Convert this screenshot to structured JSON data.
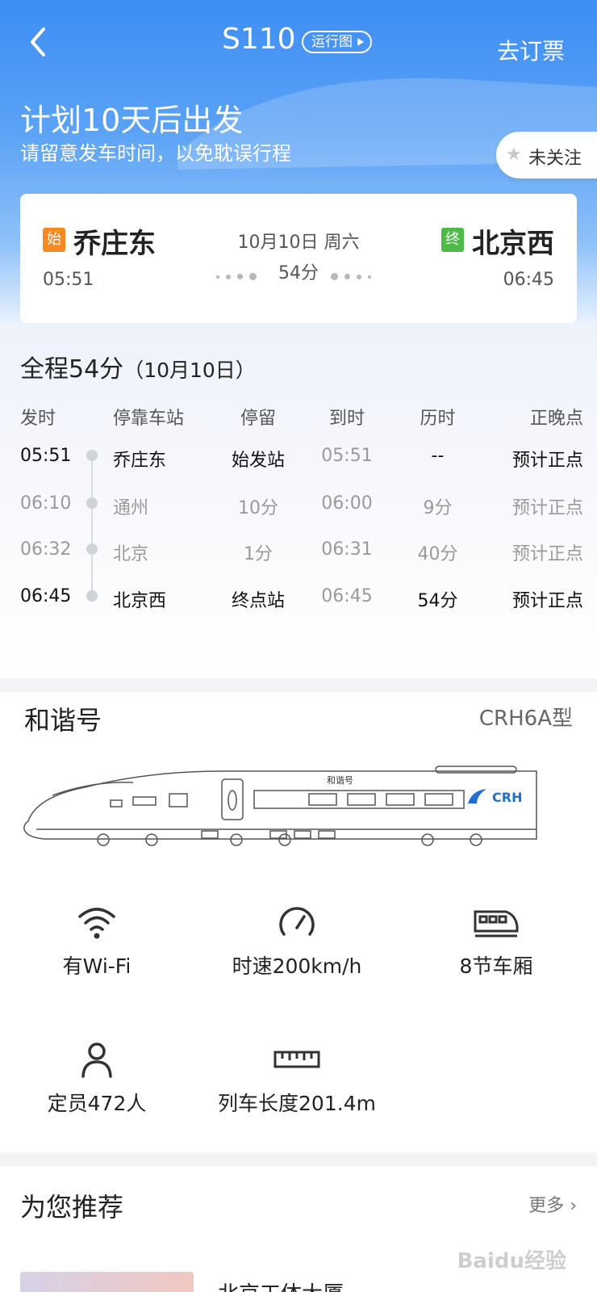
{
  "header": {
    "train_no": "S110",
    "map_badge": "运行图",
    "book_label": "去订票",
    "plan_title": "计划10天后出发",
    "plan_sub": "请留意发车时间，以免耽误行程",
    "follow_label": "未关注"
  },
  "route": {
    "start_tag": "始",
    "end_tag": "终",
    "from": "乔庄东",
    "to": "北京西",
    "depart": "05:51",
    "arrive": "06:45",
    "date": "10月10日 周六",
    "duration": "54分"
  },
  "schedule": {
    "title": "全程54分",
    "title_date": "（10月10日）",
    "headers": [
      "发时",
      "停靠车站",
      "停留",
      "到时",
      "历时",
      "正晚点"
    ],
    "rows": [
      {
        "dep": "05:51",
        "station": "乔庄东",
        "stay": "始发站",
        "arr": "05:51",
        "elapsed": "--",
        "status": "预计正点"
      },
      {
        "dep": "06:10",
        "station": "通州",
        "stay": "10分",
        "arr": "06:00",
        "elapsed": "9分",
        "status": "预计正点"
      },
      {
        "dep": "06:32",
        "station": "北京",
        "stay": "1分",
        "arr": "06:31",
        "elapsed": "40分",
        "status": "预计正点"
      },
      {
        "dep": "06:45",
        "station": "北京西",
        "stay": "终点站",
        "arr": "06:45",
        "elapsed": "54分",
        "status": "预计正点"
      }
    ]
  },
  "train": {
    "name": "和谐号",
    "model": "CRH6A型",
    "image_text_name": "和谐号",
    "image_text_brand": "CRH",
    "features": [
      {
        "icon": "wifi-icon",
        "label": "有Wi-Fi"
      },
      {
        "icon": "speedometer-icon",
        "label": "时速200km/h"
      },
      {
        "icon": "train-car-icon",
        "label": "8节车厢"
      },
      {
        "icon": "person-icon",
        "label": "定员472人"
      },
      {
        "icon": "ruler-icon",
        "label": "列车长度201.4m"
      }
    ]
  },
  "recommend": {
    "title": "为您推荐",
    "more": "更多",
    "item_title": "北京工体大厦",
    "watermark": "Baidu经验"
  },
  "colors": {
    "accent_blue": "#3d8df3",
    "start_tag": "#f7891f",
    "end_tag": "#4cbb47"
  }
}
